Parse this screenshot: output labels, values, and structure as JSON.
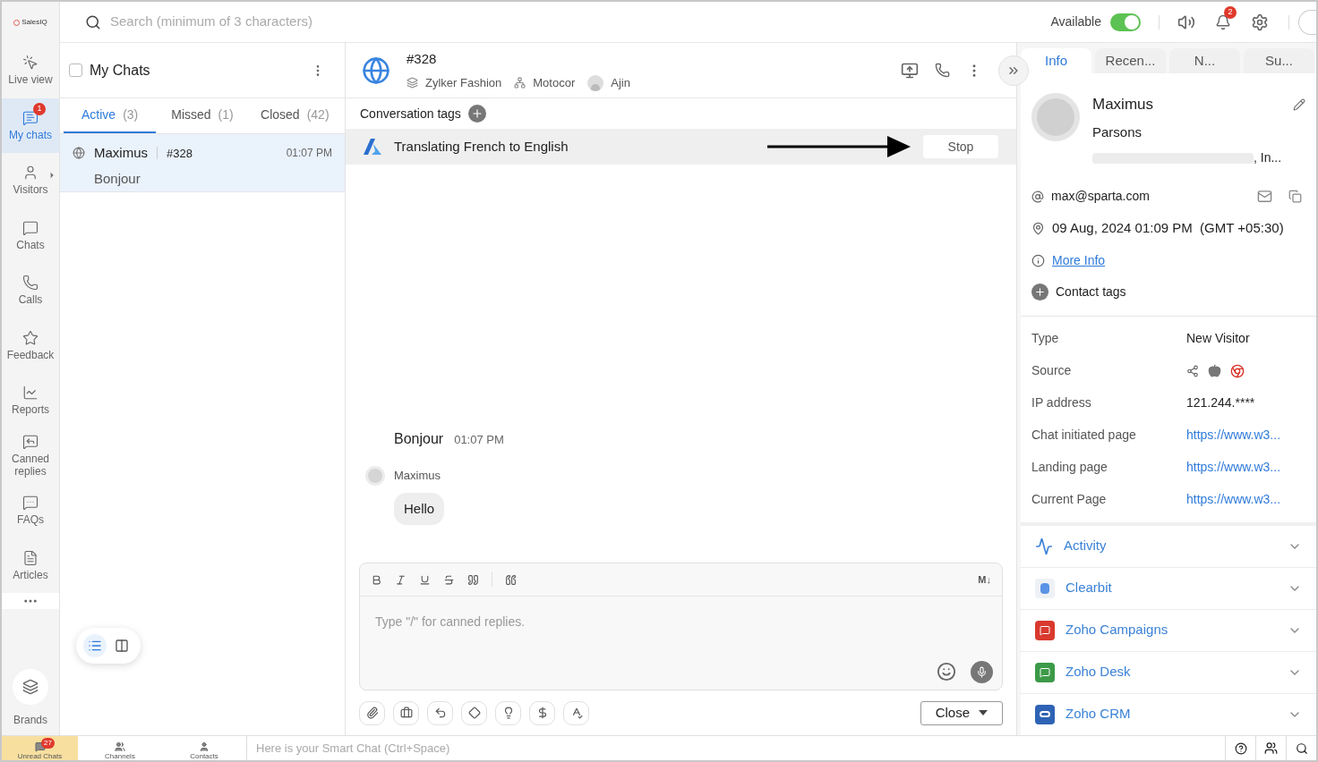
{
  "app": {
    "logo": "SalesIQ"
  },
  "search": {
    "placeholder": "Search (minimum of 3 characters)"
  },
  "status": {
    "label": "Available",
    "on": true
  },
  "notifications": {
    "count": "2"
  },
  "nav": [
    {
      "kind": "live",
      "label": "Live view",
      "selected": false
    },
    {
      "kind": "mychats",
      "label": "My chats",
      "selected": true,
      "badge": "1"
    },
    {
      "kind": "visitors",
      "label": "Visitors",
      "selected": false
    },
    {
      "kind": "chats",
      "label": "Chats",
      "selected": false
    },
    {
      "kind": "calls",
      "label": "Calls",
      "selected": false
    },
    {
      "kind": "feedback",
      "label": "Feedback",
      "selected": false
    },
    {
      "kind": "reports",
      "label": "Reports",
      "selected": false
    },
    {
      "kind": "canned",
      "label": "Canned replies",
      "selected": false
    },
    {
      "kind": "faqs",
      "label": "FAQs",
      "selected": false
    },
    {
      "kind": "articles",
      "label": "Articles",
      "selected": false
    }
  ],
  "brands": {
    "label": "Brands"
  },
  "chat_list": {
    "title": "My Chats",
    "select_all": {
      "checked": false
    },
    "tabs": [
      {
        "label": "Active",
        "count": "(3)",
        "selected": true
      },
      {
        "label": "Missed",
        "count": "(1)",
        "selected": false
      },
      {
        "label": "Closed",
        "count": "(42)",
        "selected": false
      }
    ],
    "chats": [
      {
        "name": "Maximus",
        "id": "#328",
        "time": "01:07 PM",
        "preview": "Bonjour",
        "selected": true
      }
    ],
    "view_toggle": [
      {
        "kind": "list",
        "selected": true
      },
      {
        "kind": "columns",
        "selected": false
      }
    ]
  },
  "conversation": {
    "id": "#328",
    "brand": "Zylker Fashion",
    "department": "Motocor",
    "agent": "Ajin",
    "tags_label": "Conversation tags",
    "translation": {
      "text": "Translating French to English",
      "button": "Stop"
    },
    "messages": [
      {
        "kind": "agent",
        "text": "Bonjour",
        "time": "01:07 PM"
      },
      {
        "kind": "visitor",
        "sender": "Maximus",
        "text": "Hello"
      }
    ],
    "composer": {
      "placeholder": "Type \"/\" for canned replies.",
      "markdown": "M↓",
      "close": "Close"
    }
  },
  "info_panel": {
    "tabs": [
      {
        "label": "Info",
        "selected": true
      },
      {
        "label": "Recen...",
        "selected": false
      },
      {
        "label": "N...",
        "selected": false
      },
      {
        "label": "Su...",
        "selected": false
      }
    ],
    "visitor": {
      "first_name": "Maximus",
      "last_name": "Parsons",
      "location": ", In...",
      "email": "max@sparta.com",
      "local_time": "09 Aug, 2024 01:09 PM  (GMT +05:30)",
      "more_info": "More Info",
      "contact_tags": "Contact tags"
    },
    "details": [
      {
        "kind": "text",
        "label": "Type",
        "value": "New Visitor"
      },
      {
        "kind": "sources",
        "label": "Source"
      },
      {
        "kind": "text",
        "label": "IP address",
        "value": "121.244.****"
      },
      {
        "kind": "link",
        "label": "Chat initiated page",
        "value": "https://www.w3..."
      },
      {
        "kind": "link",
        "label": "Landing page",
        "value": "https://www.w3..."
      },
      {
        "kind": "link",
        "label": "Current Page",
        "value": "https://www.w3..."
      }
    ],
    "integrations": [
      {
        "kind": "activity",
        "name": "Activity",
        "color": "#ffffff"
      },
      {
        "kind": "clearbit",
        "name": "Clearbit",
        "color": "#eef1f5"
      },
      {
        "kind": "campaigns",
        "name": "Zoho Campaigns",
        "color": "#d9392e"
      },
      {
        "kind": "desk",
        "name": "Zoho Desk",
        "color": "#3c9a48"
      },
      {
        "kind": "crm",
        "name": "Zoho CRM",
        "color": "#2f63b5"
      }
    ]
  },
  "bottom_bar": {
    "tabs": [
      {
        "kind": "unread",
        "label": "Unread Chats",
        "badge": "27",
        "selected": true
      },
      {
        "kind": "channels",
        "label": "Channels",
        "selected": false
      },
      {
        "kind": "contacts",
        "label": "Contacts",
        "selected": false
      }
    ],
    "smart_chat": {
      "placeholder": "Here is your Smart Chat (Ctrl+Space)"
    }
  }
}
